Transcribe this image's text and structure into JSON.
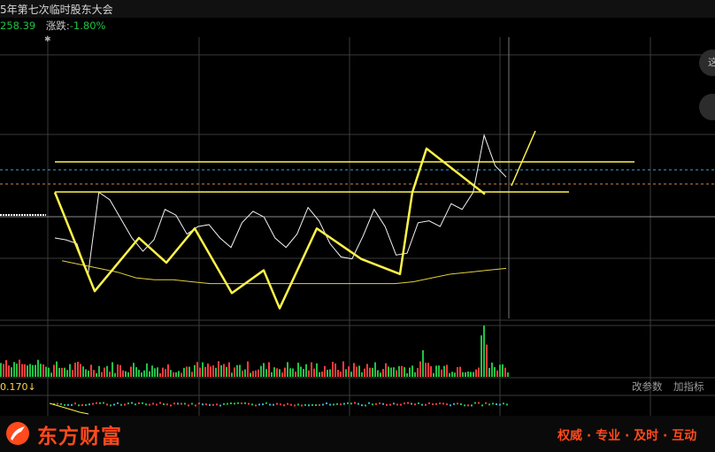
{
  "header": {
    "title": "5年第七次临时股东大会",
    "price": "258.39",
    "change_label": "涨跌:",
    "change_value": "-1.80%"
  },
  "right_buttons": {
    "top_label": "这",
    "second_label": ""
  },
  "volume_panel": {
    "label": "0.170↓"
  },
  "indicator_panel": {
    "params_button": "改参数",
    "add_indicator_button": "加指标"
  },
  "footer": {
    "logo_text": "东方财富",
    "slogan": "权威 · 专业 · 及时 · 互动"
  },
  "colors": {
    "background": "#000000",
    "up_red": "#ff3b3b",
    "down_green": "#21c245",
    "yellow_line": "#fff34a",
    "brand_orange": "#ff4a1c"
  },
  "chart_data": {
    "type": "line",
    "title": "",
    "xlabel": "",
    "ylabel": "",
    "series": [
      {
        "values": [
          0.4,
          0.39,
          0.37,
          0.2,
          0.64,
          0.6,
          0.5,
          0.4,
          0.33,
          0.39,
          0.55,
          0.52,
          0.42,
          0.46,
          0.47,
          0.4,
          0.35,
          0.48,
          0.54,
          0.51,
          0.4,
          0.35,
          0.42,
          0.56,
          0.49,
          0.37,
          0.3,
          0.29,
          0.41,
          0.55,
          0.46,
          0.31,
          0.32,
          0.48,
          0.49,
          0.46,
          0.58,
          0.55,
          0.64,
          0.94,
          0.78,
          0.72
        ]
      },
      {
        "values": [
          0.28,
          0.26,
          0.24,
          0.22,
          0.19,
          0.18,
          0.18,
          0.17,
          0.16,
          0.16,
          0.16,
          0.16,
          0.16,
          0.16,
          0.16,
          0.16,
          0.16,
          0.16,
          0.16,
          0.17,
          0.19,
          0.21,
          0.22,
          0.23,
          0.24
        ]
      },
      {
        "values": [
          0.64,
          0.12,
          0.4,
          0.27,
          0.45,
          0.11,
          0.23,
          0.03,
          0.45,
          0.29,
          0.21,
          0.64,
          0.87,
          0.63
        ]
      }
    ],
    "reference_lines": [
      "dashed-blue-upper",
      "dashed-orange",
      "gray-baseline"
    ]
  }
}
